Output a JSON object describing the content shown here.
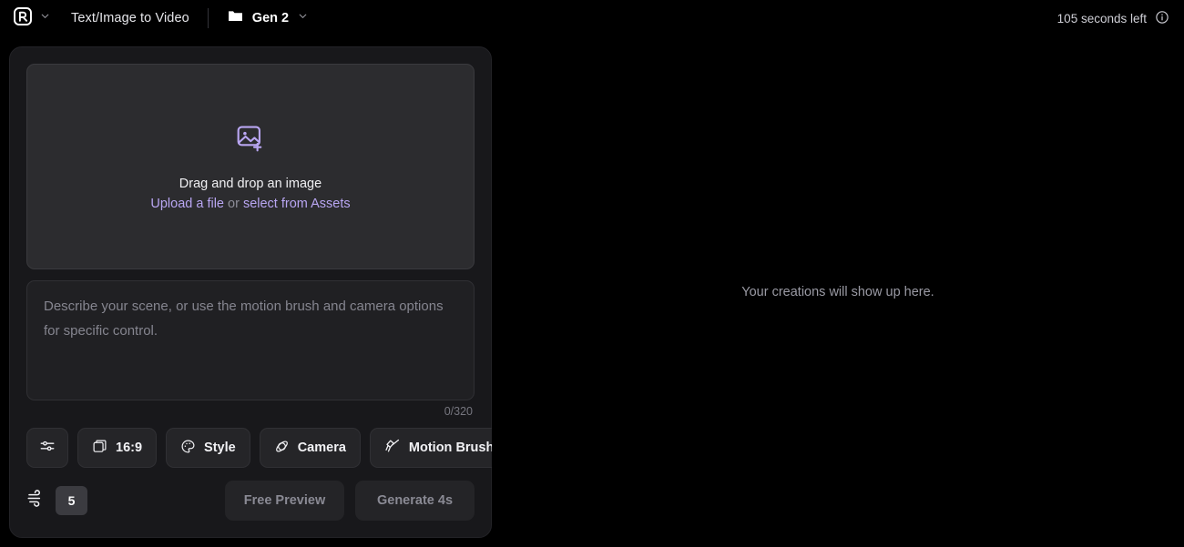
{
  "topbar": {
    "logo_icon": "runway-logo-icon",
    "logo_chevron_icon": "chevron-down-icon",
    "title": "Text/Image to Video",
    "folder_icon": "folder-icon",
    "project_name": "Gen 2",
    "project_chevron_icon": "chevron-down-icon",
    "credits_text": "105 seconds left",
    "info_icon": "info-circle-icon"
  },
  "dropzone": {
    "icon": "image-add-icon",
    "title": "Drag and drop an image",
    "upload_link": "Upload a file",
    "or_text": " or ",
    "assets_link": "select from Assets"
  },
  "prompt": {
    "value": "",
    "placeholder": "Describe your scene, or use the motion brush and camera options for specific control.",
    "counter": "0/320"
  },
  "tools": [
    {
      "name": "settings",
      "icon": "sliders-icon",
      "label": ""
    },
    {
      "name": "aspect-ratio",
      "icon": "aspect-ratio-icon",
      "label": "16:9"
    },
    {
      "name": "style",
      "icon": "palette-icon",
      "label": "Style"
    },
    {
      "name": "camera",
      "icon": "camera-orbit-icon",
      "label": "Camera"
    },
    {
      "name": "motion-brush",
      "icon": "brush-icon",
      "label": "Motion Brush"
    }
  ],
  "bottom": {
    "duration_icon": "wind-icon",
    "duration_value": "5",
    "free_preview_label": "Free Preview",
    "generate_label": "Generate 4s"
  },
  "preview": {
    "empty_message": "Your creations will show up here."
  },
  "colors": {
    "background": "#000000",
    "panel": "#18181b",
    "dropzone": "#2c2c2f",
    "accent_link": "#b9a6f2",
    "text_primary": "#f0f0f3",
    "text_muted": "#8d8d98"
  }
}
